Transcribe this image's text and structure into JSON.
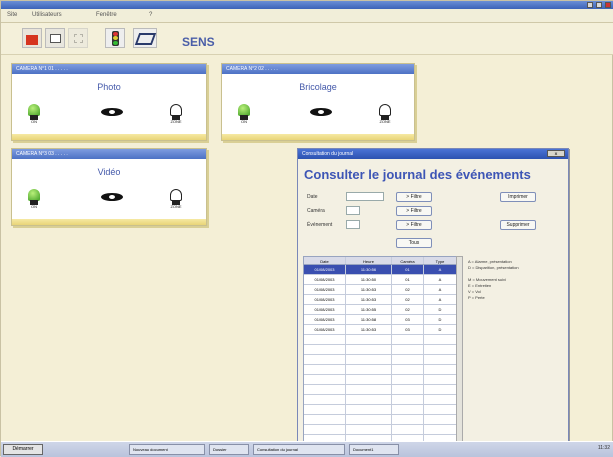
{
  "app": {
    "menu": [
      "Site",
      "Utilisateurs",
      "Fenêtre",
      "?"
    ],
    "brand": "SENS"
  },
  "panels": [
    {
      "header": "CAMERA N°1  01   .  .  .  .  .",
      "title": "Photo"
    },
    {
      "header": "CAMERA N°2  02   .  .  .  .  .",
      "title": "Bricolage"
    },
    {
      "header": "CAMERA N°3  03   .  .  .  .  .",
      "title": "Vidéo"
    }
  ],
  "panel_icons": {
    "on_label": "ON",
    "alarm_label": "ZONE"
  },
  "journal": {
    "window_title": "Consultation du journal",
    "close_label": "ⅹ",
    "heading": "Consulter le journal des événements",
    "fields": [
      {
        "label": "Date",
        "value": ""
      },
      {
        "label": "Caméra",
        "value": ""
      },
      {
        "label": "Événement",
        "value": ""
      }
    ],
    "filter_buttons": [
      "> Filtre",
      "> Filtre",
      "> Filtre",
      "Tous"
    ],
    "side_buttons": [
      "Imprimer",
      "Supprimer"
    ],
    "columns": [
      "Date",
      "Heure",
      "Caméra",
      "Type"
    ],
    "rows": [
      {
        "date": "01/08/2003",
        "time": "11:30:56",
        "cam": "01",
        "type": "A"
      },
      {
        "date": "01/08/2003",
        "time": "11:30:50",
        "cam": "01",
        "type": "A"
      },
      {
        "date": "01/08/2003",
        "time": "11:30:53",
        "cam": "02",
        "type": "A"
      },
      {
        "date": "01/08/2003",
        "time": "11:30:53",
        "cam": "02",
        "type": "A"
      },
      {
        "date": "01/08/2003",
        "time": "11:30:55",
        "cam": "02",
        "type": "D"
      },
      {
        "date": "01/08/2003",
        "time": "11:30:58",
        "cam": "03",
        "type": "D"
      },
      {
        "date": "01/08/2003",
        "time": "11:30:53",
        "cam": "03",
        "type": "D"
      }
    ],
    "legend": [
      "A = Alarme, présentation",
      "D = Disparition, présentation",
      "",
      "M = Mouvement suivi",
      "E = Entretien",
      "V = Vol",
      "P = Perte"
    ]
  },
  "taskbar": {
    "start": "Démarrer",
    "tasks": [
      "Nouveau document",
      "Dossier",
      "Consultation du journal",
      "Document1"
    ],
    "clock": "11:32"
  }
}
